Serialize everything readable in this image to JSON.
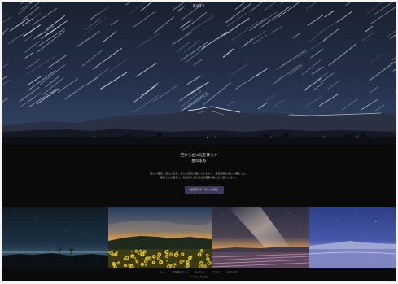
{
  "site": {
    "logo_text": "星のまち"
  },
  "intro": {
    "title_line1": "空から右に光を降らす",
    "title_line2": "星のまち",
    "body_line1": "美しい夜空、澄んだ空気、豊かな自然に囲まれたまちで、星空観察を楽しむ暮らしを。",
    "body_line2": "季節ごとの星景と、地域の人々が伝える夜空の魅力をご紹介します。",
    "cta_label": "星景写真ギャラリーを見る"
  },
  "gallery": [
    {
      "name": "night-lake"
    },
    {
      "name": "sunflower-sunset"
    },
    {
      "name": "milky-way-field"
    },
    {
      "name": "snowy-meadow"
    }
  ],
  "footer": {
    "links": [
      "ホーム",
      "星空観察スポット",
      "ギャラリー",
      "アクセス",
      "お問い合わせ"
    ],
    "copyright": "© 星のまち観光協会"
  }
}
